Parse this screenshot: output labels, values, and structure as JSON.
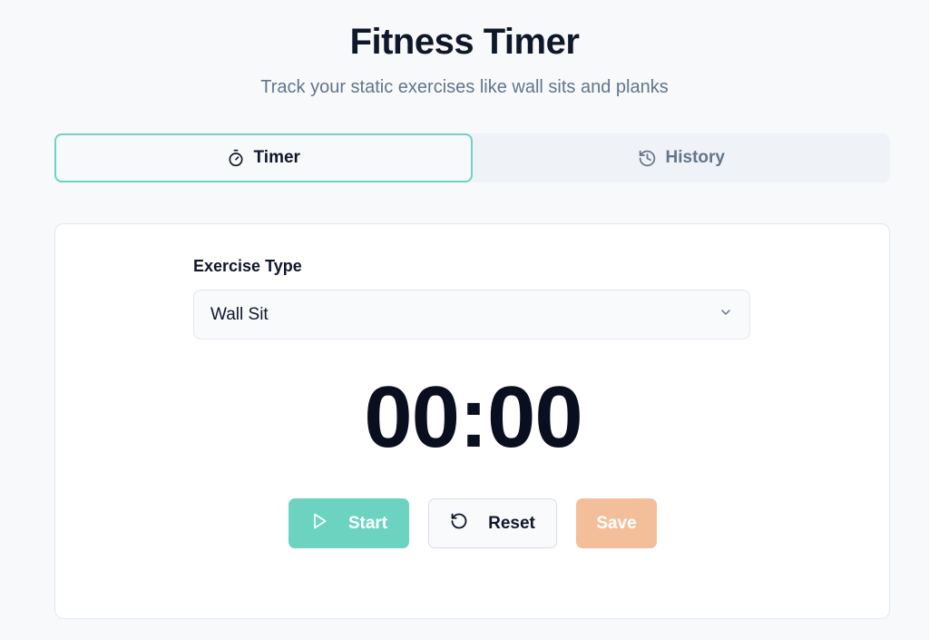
{
  "header": {
    "title": "Fitness Timer",
    "subtitle": "Track your static exercises like wall sits and planks"
  },
  "tabs": [
    {
      "label": "Timer",
      "icon": "stopwatch-icon",
      "active": true
    },
    {
      "label": "History",
      "icon": "history-icon",
      "active": false
    }
  ],
  "exercise": {
    "label": "Exercise Type",
    "selected": "Wall Sit"
  },
  "timer": {
    "display": "00:00"
  },
  "controls": {
    "start_label": "Start",
    "reset_label": "Reset",
    "save_label": "Save"
  },
  "colors": {
    "accent": "#6dd3c1",
    "save": "#f3bf9b",
    "text": "#0f172a",
    "muted": "#64748b"
  }
}
